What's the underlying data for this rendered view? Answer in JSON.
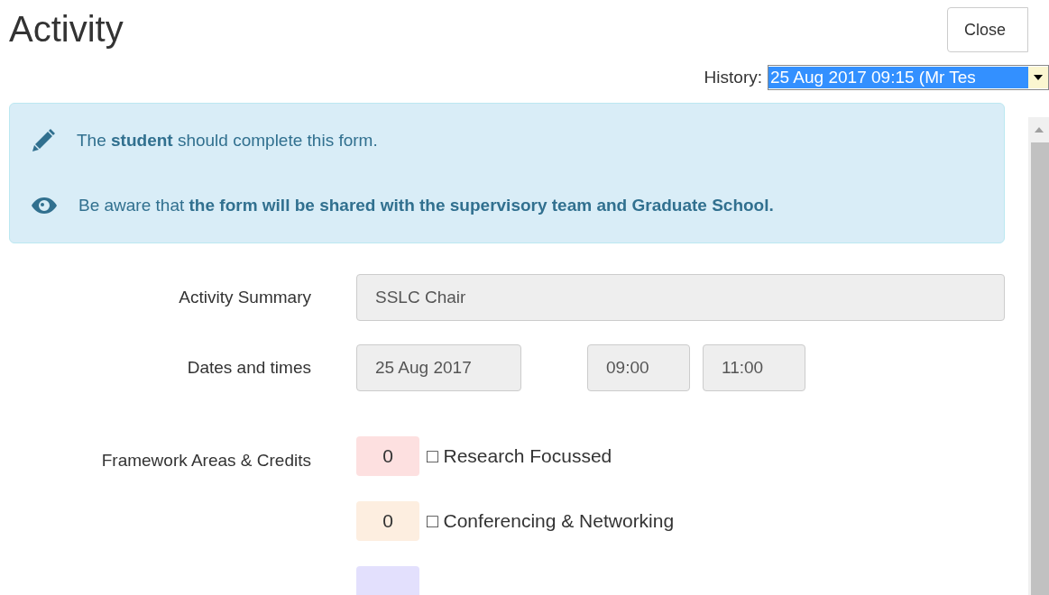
{
  "title": "Activity",
  "close_button": "Close",
  "history": {
    "label": "History:",
    "value": "25 Aug 2017 09:15 (Mr Tes"
  },
  "alert": [
    {
      "kind": "pencil",
      "text": "The **student** should complete this form."
    },
    {
      "kind": "eye",
      "text": "Be aware that **the form will be shared with the supervisory team and Graduate School.**"
    }
  ],
  "activity_summary": {
    "label": "Activity Summary",
    "value": "SSLC Chair"
  },
  "dates_and_times": {
    "label": "Dates and times",
    "date": "25 Aug 2017",
    "start": "09:00",
    "end": "11:00"
  },
  "framework": {
    "label": "Framework Areas & Credits",
    "items": [
      {
        "credits": "0",
        "marker": "□",
        "name": "Research Focussed",
        "color": "#fde0e0"
      },
      {
        "credits": "0",
        "marker": "□",
        "name": "Conferencing & Networking",
        "color": "#fdeee0"
      },
      {
        "color": "#e3e0fd"
      }
    ]
  }
}
